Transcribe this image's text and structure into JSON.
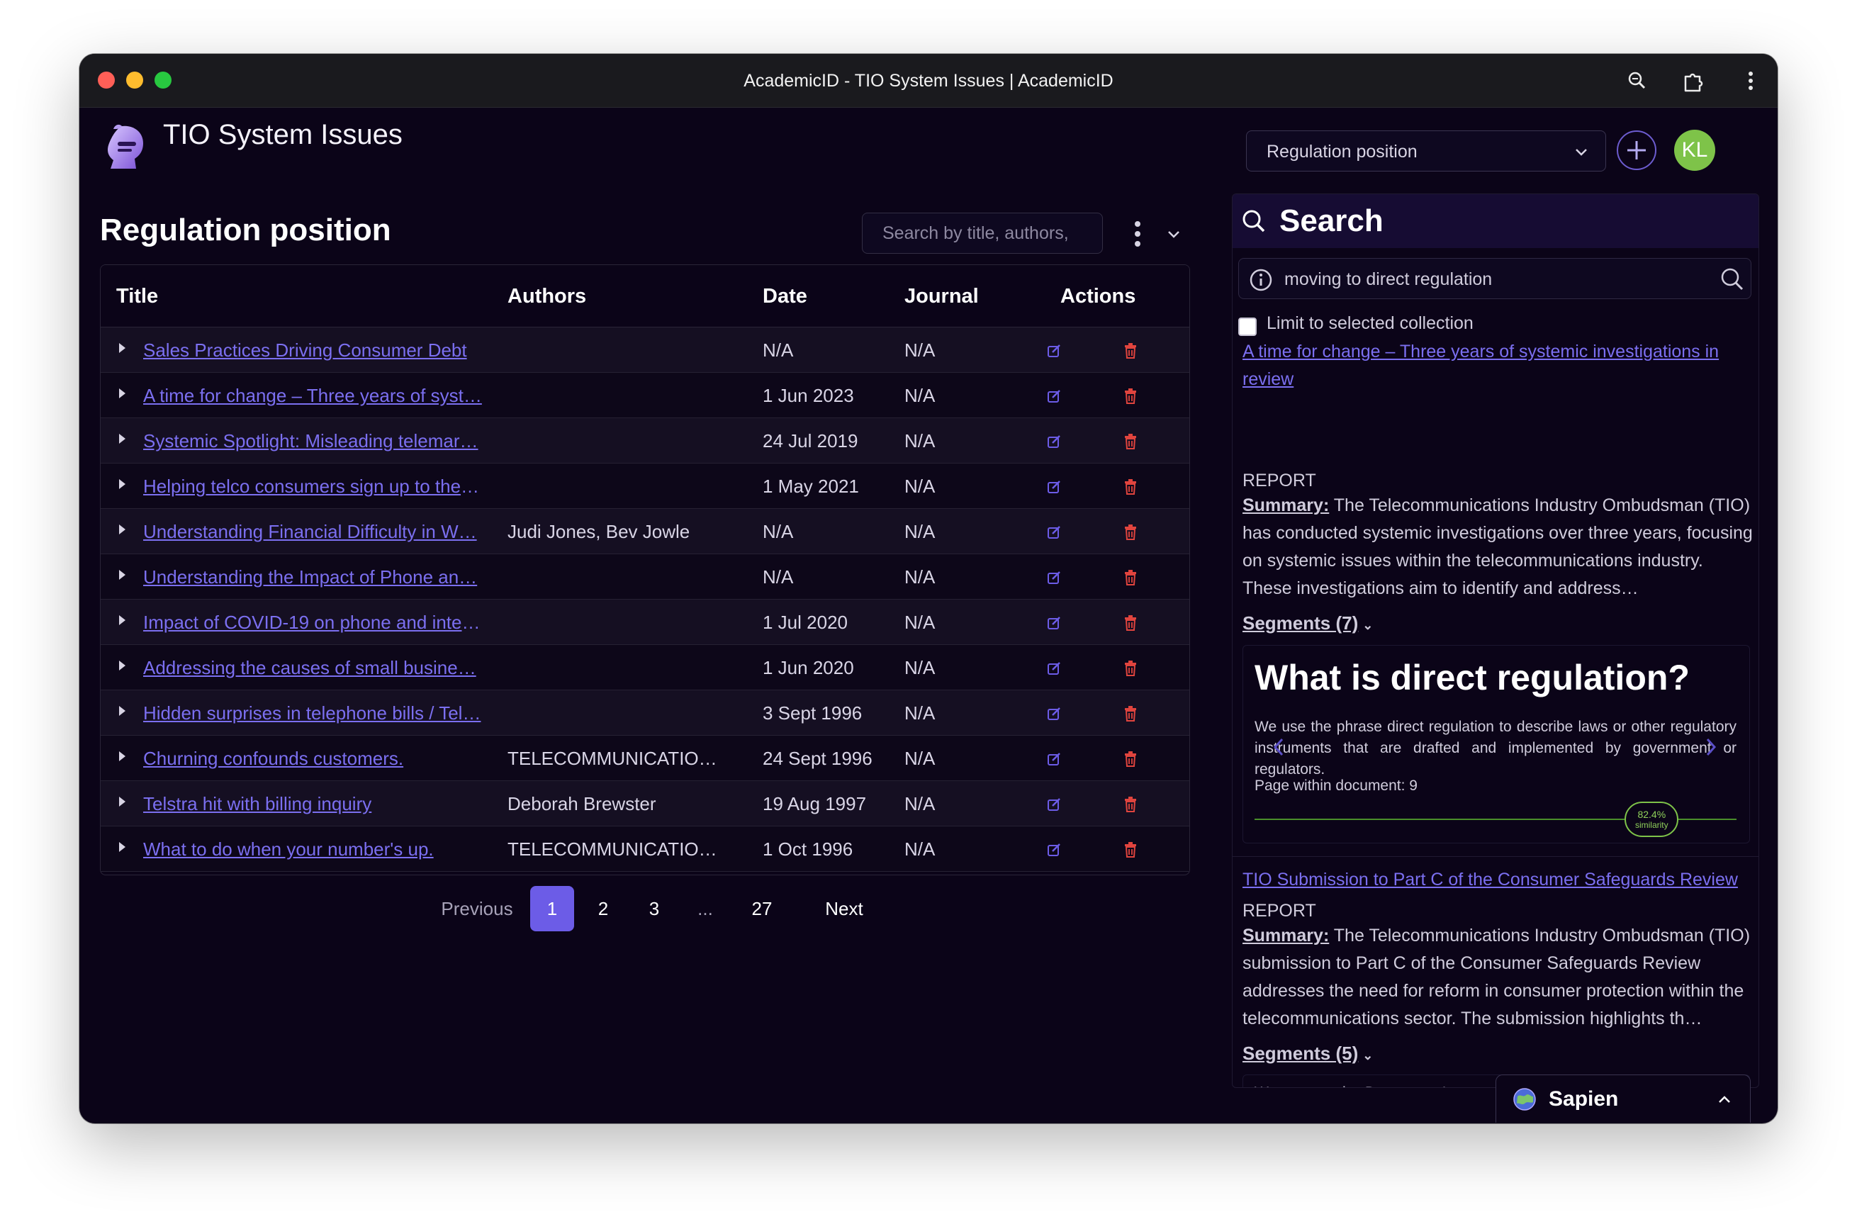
{
  "window": {
    "title": "AcademicID - TIO System Issues | AcademicID",
    "traffic_lights": [
      "#ff5f57",
      "#febc2e",
      "#28c840"
    ]
  },
  "header": {
    "app_title": "TIO System Issues",
    "collection_select": "Regulation position",
    "avatar_initials": "KL",
    "avatar_color": "#7ec349"
  },
  "main": {
    "title": "Regulation position",
    "search_placeholder": "Search by title, authors,",
    "columns": {
      "title": "Title",
      "authors": "Authors",
      "date": "Date",
      "journal": "Journal",
      "actions": "Actions"
    },
    "rows": [
      {
        "title": "Sales Practices Driving Consumer Debt",
        "authors": "",
        "date": "N/A",
        "journal": "N/A"
      },
      {
        "title": "A time for change – Three years of syst…",
        "authors": "",
        "date": "1 Jun 2023",
        "journal": "N/A"
      },
      {
        "title": "Systemic Spotlight: Misleading telemar…",
        "authors": "",
        "date": "24 Jul 2019",
        "journal": "N/A"
      },
      {
        "title": "Helping telco consumers sign up to the …",
        "authors": "",
        "date": "1 May 2021",
        "journal": "N/A"
      },
      {
        "title": "Understanding Financial Difficulty in W…",
        "authors": "Judi Jones, Bev Jowle",
        "date": "N/A",
        "journal": "N/A"
      },
      {
        "title": "Understanding the Impact of Phone an…",
        "authors": "",
        "date": "N/A",
        "journal": "N/A"
      },
      {
        "title": "Impact of COVID-19 on phone and inter…",
        "authors": "",
        "date": "1 Jul 2020",
        "journal": "N/A"
      },
      {
        "title": "Addressing the causes of small busine…",
        "authors": "",
        "date": "1 Jun 2020",
        "journal": "N/A"
      },
      {
        "title": "Hidden surprises in telephone bills / Tel…",
        "authors": "",
        "date": "3 Sept 1996",
        "journal": "N/A"
      },
      {
        "title": "Churning confounds customers.",
        "authors": "TELECOMMUNICATIONS I…",
        "date": "24 Sept 1996",
        "journal": "N/A"
      },
      {
        "title": "Telstra hit with billing inquiry",
        "authors": "Deborah Brewster",
        "date": "19 Aug 1997",
        "journal": "N/A"
      },
      {
        "title": "What to do when your number's up.",
        "authors": "TELECOMMUNICATIONS I…",
        "date": "1 Oct 1996",
        "journal": "N/A"
      }
    ],
    "pagination": {
      "previous": "Previous",
      "pages": [
        "1",
        "2",
        "3",
        "...",
        "27"
      ],
      "current": "1",
      "next": "Next"
    }
  },
  "search_panel": {
    "title": "Search",
    "query": "moving to direct regulation",
    "limit_label": "Limit to selected collection",
    "limit_checked": false,
    "results": [
      {
        "title": "A time for change – Three years of systemic investigations in review",
        "type": "REPORT",
        "summary_label": "Summary:",
        "summary": "The Telecommunications Industry Ombudsman (TIO) has conducted systemic investigations over three years, focusing on systemic issues within the telecommunications industry. These investigations aim to identify and address…",
        "segments_label": "Segments (7)",
        "segment": {
          "heading": "What is direct regulation?",
          "text": "We use the phrase direct regulation to describe laws or other regulatory instruments that are drafted and implemented by government or regulators.",
          "page": "Page within document: 9",
          "similarity": "82.4%",
          "similarity_label": "similarity",
          "similarity_value": 0.824
        }
      },
      {
        "title": "TIO Submission to Part C of the Consumer Safeguards Review",
        "type": "REPORT",
        "summary_label": "Summary:",
        "summary": "The Telecommunications Industry Ombudsman (TIO) submission to Part C of the Consumer Safeguards Review addresses the need for reform in consumer protection within the telecommunications sector. The submission highlights th…",
        "segments_label": "Segments (5)",
        "segment_text": "We support the Department's proposal for direct regulation of essential consumer protection matters. We encourage the Department to consider consolidating all essential"
      }
    ]
  },
  "assistant": {
    "label": "Sapien"
  },
  "colors": {
    "accent": "#6c5ce7",
    "link": "#7b6ff0",
    "delete": "#e0443e",
    "background": "#0b0418"
  }
}
